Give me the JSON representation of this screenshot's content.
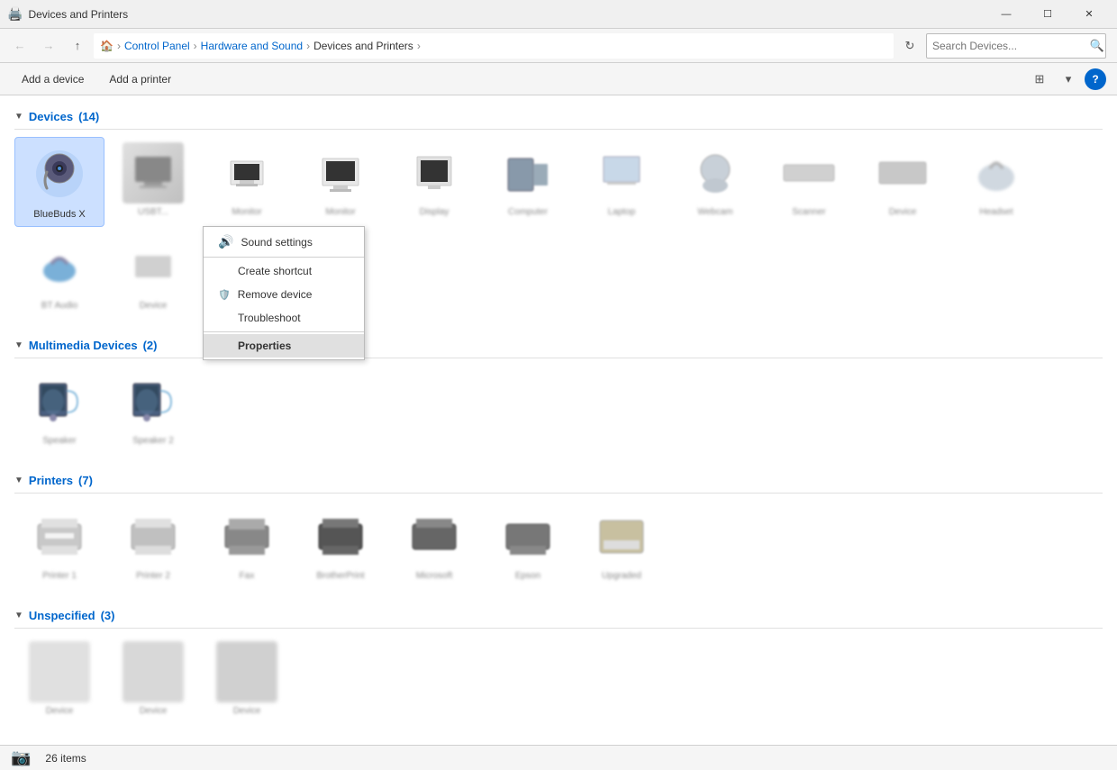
{
  "window": {
    "title": "Devices and Printers",
    "icon": "🖨️"
  },
  "titlebar": {
    "minimize": "—",
    "maximize": "☐",
    "close": "✕"
  },
  "addressbar": {
    "breadcrumbs": [
      "Control Panel",
      "Hardware and Sound",
      "Devices and Printers"
    ],
    "search_placeholder": "Search Devices...",
    "search_value": ""
  },
  "toolbar": {
    "add_device": "Add a device",
    "add_printer": "Add a printer"
  },
  "sections": {
    "devices": {
      "label": "Devices",
      "count": "(14)"
    },
    "multimedia": {
      "label": "Multimedia Devices",
      "count": "(2)"
    },
    "printers": {
      "label": "Printers",
      "count": "(7)"
    },
    "unspecified": {
      "label": "Unspecified",
      "count": "(3)"
    }
  },
  "selected_device": {
    "name": "BlueBuds X"
  },
  "context_menu": {
    "sound_settings": "Sound settings",
    "create_shortcut": "Create shortcut",
    "remove_device": "Remove device",
    "troubleshoot": "Troubleshoot",
    "properties": "Properties"
  },
  "status_bar": {
    "count": "26 items"
  }
}
